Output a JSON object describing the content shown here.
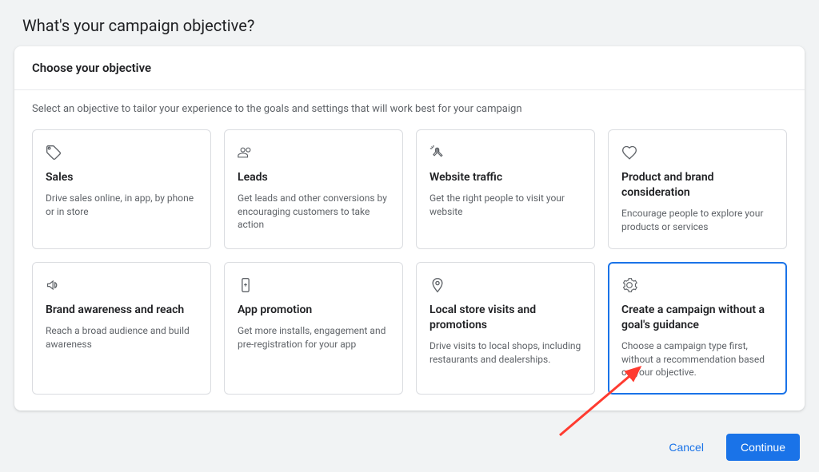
{
  "page": {
    "title": "What's your campaign objective?"
  },
  "card": {
    "header": "Choose your objective",
    "subtitle": "Select an objective to tailor your experience to the goals and settings that will work best for your campaign"
  },
  "objectives": [
    {
      "icon": "tag",
      "title": "Sales",
      "desc": "Drive sales online, in app, by phone or in store",
      "selected": false
    },
    {
      "icon": "leads",
      "title": "Leads",
      "desc": "Get leads and other conversions by encouraging customers to take action",
      "selected": false
    },
    {
      "icon": "click",
      "title": "Website traffic",
      "desc": "Get the right people to visit your website",
      "selected": false
    },
    {
      "icon": "heart",
      "title": "Product and brand consideration",
      "desc": "Encourage people to explore your products or services",
      "selected": false
    },
    {
      "icon": "megaphone",
      "title": "Brand awareness and reach",
      "desc": "Reach a broad audience and build awareness",
      "selected": false
    },
    {
      "icon": "phone",
      "title": "App promotion",
      "desc": "Get more installs, engagement and pre-registration for your app",
      "selected": false
    },
    {
      "icon": "pin",
      "title": "Local store visits and promotions",
      "desc": "Drive visits to local shops, including restaurants and dealerships.",
      "selected": false
    },
    {
      "icon": "gear",
      "title": "Create a campaign without a goal's guidance",
      "desc": "Choose a campaign type first, without a recommendation based on your objective.",
      "selected": true
    }
  ],
  "footer": {
    "cancel_label": "Cancel",
    "continue_label": "Continue"
  },
  "colors": {
    "primary": "#1a73e8",
    "text_primary": "#202124",
    "text_secondary": "#5f6368",
    "border": "#dadce0",
    "arrow": "#ff3b30"
  }
}
